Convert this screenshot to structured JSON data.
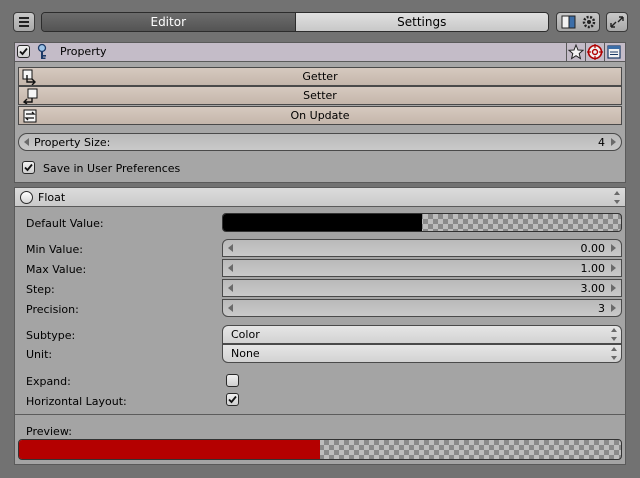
{
  "header": {
    "tabs": [
      {
        "label": "Editor",
        "active": true
      },
      {
        "label": "Settings",
        "active": false
      }
    ],
    "icons": [
      "menu-icon",
      "mode-toggle-icon",
      "gear-icon",
      "fullscreen-icon"
    ]
  },
  "property_panel": {
    "title": "Property",
    "enabled": true,
    "icons": [
      "key-icon",
      "star-icon",
      "target-icon",
      "info-icon"
    ],
    "actions": [
      {
        "label": "Getter",
        "icon": "getter-icon"
      },
      {
        "label": "Setter",
        "icon": "setter-icon"
      },
      {
        "label": "On Update",
        "icon": "update-icon"
      }
    ],
    "property_size": {
      "label": "Property Size:",
      "value": "4"
    },
    "save_prefs": {
      "label": "Save in User Preferences",
      "checked": true
    }
  },
  "float_section": {
    "title": "Float",
    "default_value": {
      "label": "Default Value:",
      "color": "#000000",
      "alpha_fraction": 0.5
    },
    "fields": [
      {
        "label": "Min Value:",
        "value": "0.00"
      },
      {
        "label": "Max Value:",
        "value": "1.00"
      },
      {
        "label": "Step:",
        "value": "3.00"
      },
      {
        "label": "Precision:",
        "value": "3"
      }
    ],
    "subtype": {
      "label": "Subtype:",
      "value": "Color"
    },
    "unit": {
      "label": "Unit:",
      "value": "None"
    },
    "expand": {
      "label": "Expand:",
      "checked": false
    },
    "horizontal_layout": {
      "label": "Horizontal Layout:",
      "checked": true
    }
  },
  "preview": {
    "label": "Preview:",
    "color": "#b40000",
    "alpha_fraction": 0.5
  }
}
